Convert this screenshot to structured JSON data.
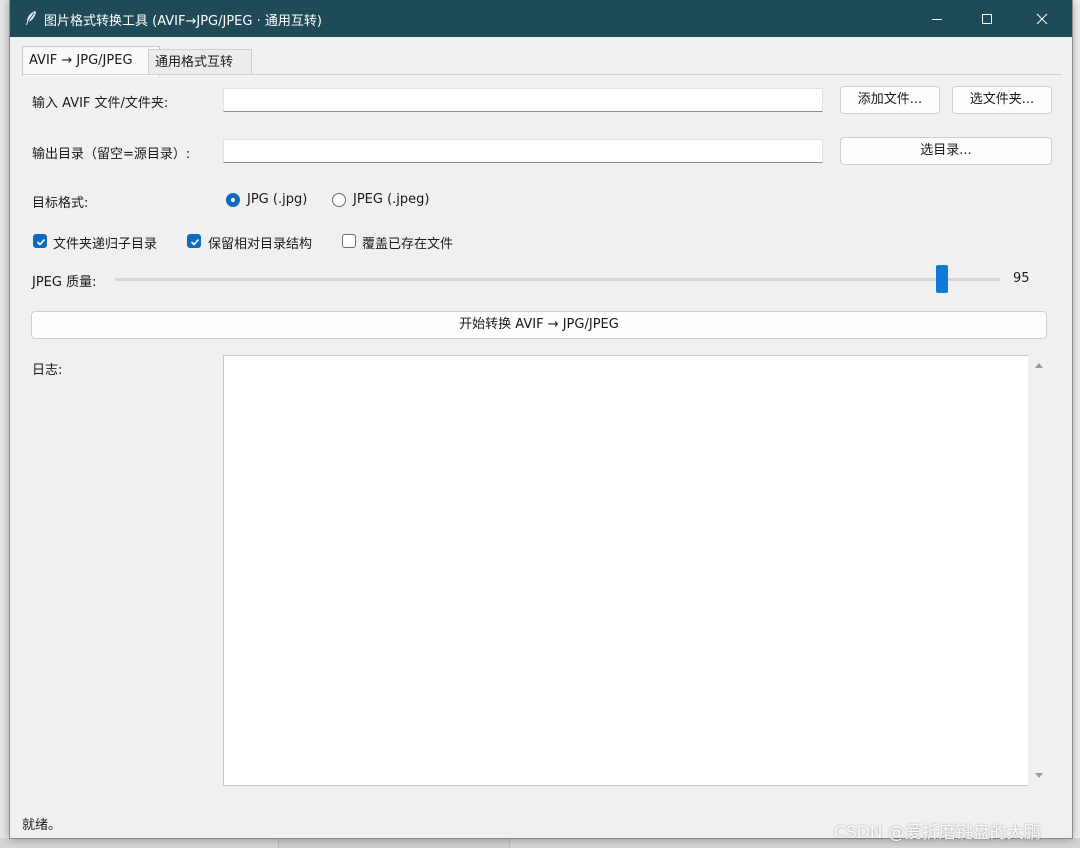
{
  "window": {
    "title": "图片格式转换工具 (AVIF→JPG/JPEG · 通用互转)"
  },
  "tabs": [
    {
      "label": "AVIF → JPG/JPEG",
      "active": true
    },
    {
      "label": "通用格式互转",
      "active": false
    }
  ],
  "input": {
    "label": "输入 AVIF 文件/文件夹:",
    "value": "",
    "add_files_button": "添加文件...",
    "choose_folder_button": "选文件夹..."
  },
  "output": {
    "label": "输出目录（留空=源目录）:",
    "value": "",
    "choose_dir_button": "选目录..."
  },
  "format": {
    "label": "目标格式:",
    "options": [
      {
        "label": "JPG (.jpg)",
        "selected": true
      },
      {
        "label": "JPEG (.jpeg)",
        "selected": false
      }
    ]
  },
  "options": [
    {
      "label": "文件夹递归子目录",
      "checked": true
    },
    {
      "label": "保留相对目录结构",
      "checked": true
    },
    {
      "label": "覆盖已存在文件",
      "checked": false
    }
  ],
  "quality": {
    "label": "JPEG 质量:",
    "value": "95",
    "level": 0.935
  },
  "start_button": "开始转换 AVIF → JPG/JPEG",
  "log": {
    "label": "日志:",
    "content": ""
  },
  "status": "就绪。",
  "watermark": "CSDN @爱折磨键盘的大鹏",
  "colors": {
    "titlebar": "#1f4a57",
    "accent": "#0f6cbd",
    "window_bg": "#f0f0f0"
  }
}
